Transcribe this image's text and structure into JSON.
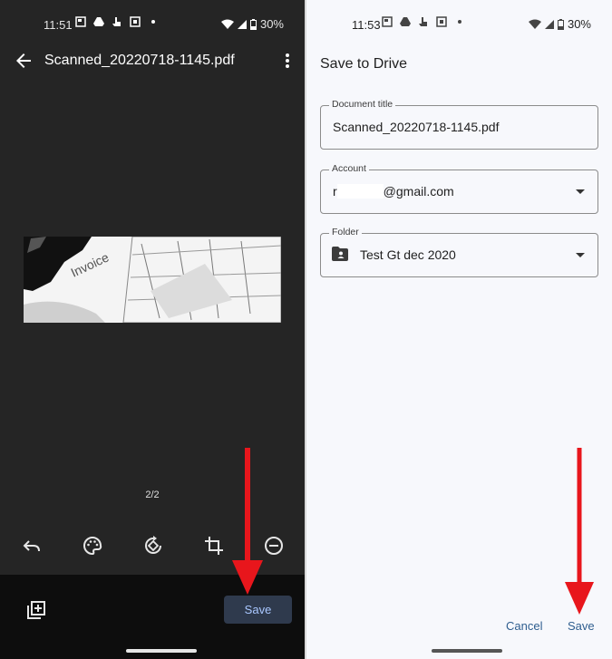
{
  "left_screen": {
    "status": {
      "time": "11:51",
      "battery": "30%"
    },
    "title": "Scanned_20220718-1145.pdf",
    "page_indicator": "2/2",
    "save_label": "Save"
  },
  "right_screen": {
    "status": {
      "time": "11:53",
      "battery": "30%"
    },
    "dialog_title": "Save to Drive",
    "document_title": {
      "label": "Document title",
      "value": "Scanned_20220718-1145.pdf"
    },
    "account": {
      "label": "Account",
      "prefix": "r",
      "value": "@gmail.com"
    },
    "folder": {
      "label": "Folder",
      "value": "Test Gt dec 2020"
    },
    "cancel_label": "Cancel",
    "save_label": "Save"
  },
  "colors": {
    "arrow": "#e8161c",
    "save_button_bg": "#2f3a4d",
    "link_text": "#2f5e8f"
  },
  "icons": {
    "left_toolbar": [
      "undo-icon",
      "palette-icon",
      "rotate-icon",
      "crop-icon",
      "delete-page-icon"
    ]
  }
}
